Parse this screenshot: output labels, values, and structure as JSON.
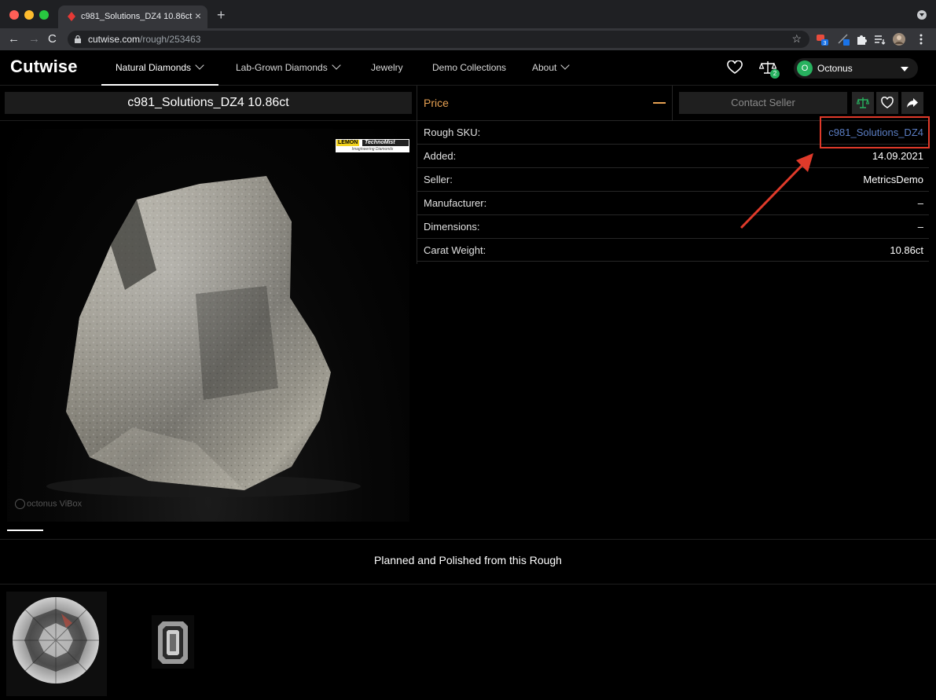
{
  "browser": {
    "tab_title": "c981_Solutions_DZ4 10.86ct",
    "tab_close": "×",
    "new_tab": "+",
    "url_host": "cutwise.com",
    "url_path": "/rough/253463",
    "back": "←",
    "forward": "→",
    "reload": "C",
    "star": "☆",
    "extension_badge": "3"
  },
  "header": {
    "logo": "Cutwise",
    "nav": {
      "natural": "Natural Diamonds",
      "labgrown": "Lab-Grown Diamonds",
      "jewelry": "Jewelry",
      "demo": "Demo Collections",
      "about": "About"
    },
    "compare_count": "2",
    "user_initial": "O",
    "user_name": "Octonus"
  },
  "product": {
    "title": "c981_Solutions_DZ4 10.86ct",
    "image_logo": {
      "lemon": "LEMON",
      "techno": "TechnoMist",
      "tagline": "Imagineering Diamonds"
    },
    "watermark": "octonus ViBox"
  },
  "price": {
    "label": "Price",
    "contact_button": "Contact Seller"
  },
  "details": [
    {
      "label": "Rough SKU:",
      "value": "c981_Solutions_DZ4",
      "is_link": true
    },
    {
      "label": "Added:",
      "value": "14.09.2021"
    },
    {
      "label": "Seller:",
      "value": "MetricsDemo"
    },
    {
      "label": "Manufacturer:",
      "value": "–"
    },
    {
      "label": "Dimensions:",
      "value": "–"
    },
    {
      "label": "Carat Weight:",
      "value": "10.86ct"
    }
  ],
  "section": {
    "title": "Planned and Polished from this Rough"
  },
  "colors": {
    "accent_orange": "#e6a052",
    "link_blue": "#5b7ec4",
    "badge_green": "#27b25f",
    "annotation_red": "#e03a2a"
  }
}
